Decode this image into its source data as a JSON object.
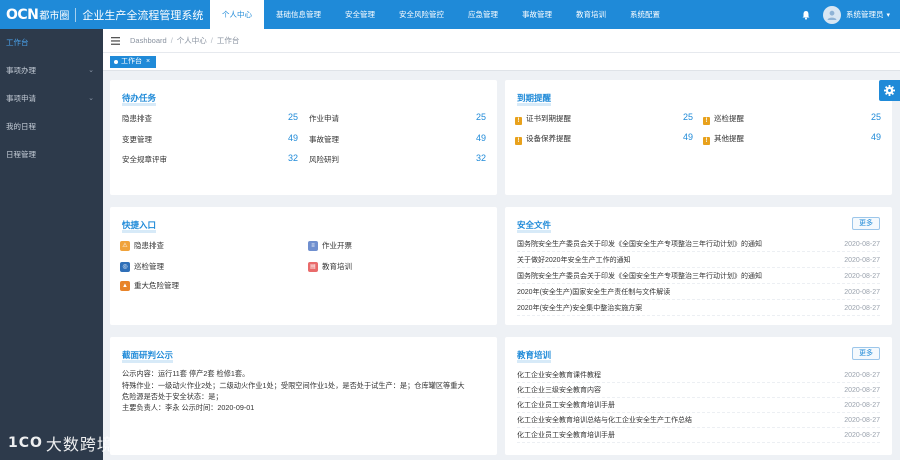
{
  "header": {
    "logo_mark": "OCN",
    "logo_name": "都市圈",
    "app_title": "企业生产全流程管理系统",
    "nav": [
      "个人中心",
      "基础信息管理",
      "安全管理",
      "安全风险管控",
      "应急管理",
      "事故管理",
      "教育培训",
      "系统配置"
    ],
    "user": "系统管理员"
  },
  "sidebar": {
    "items": [
      {
        "label": "工作台",
        "has_arrow": false
      },
      {
        "label": "事项办理",
        "has_arrow": true
      },
      {
        "label": "事项申请",
        "has_arrow": true
      },
      {
        "label": "我的日程",
        "has_arrow": false
      },
      {
        "label": "日程管理",
        "has_arrow": false
      }
    ]
  },
  "breadcrumb": [
    "Dashboard",
    "个人中心",
    "工作台"
  ],
  "tab": {
    "label": "工作台"
  },
  "tasks": {
    "title": "待办任务",
    "left": [
      {
        "label": "隐患排查",
        "value": "25"
      },
      {
        "label": "变更管理",
        "value": "49"
      },
      {
        "label": "安全规章评审",
        "value": "32"
      }
    ],
    "right": [
      {
        "label": "作业申请",
        "value": "25"
      },
      {
        "label": "事故管理",
        "value": "49"
      },
      {
        "label": "风险研判",
        "value": "32"
      }
    ]
  },
  "reminders": {
    "title": "到期提醒",
    "left": [
      {
        "label": "证书到期提醒",
        "value": "25"
      },
      {
        "label": "设备保养提醒",
        "value": "49"
      }
    ],
    "right": [
      {
        "label": "巡检提醒",
        "value": "25"
      },
      {
        "label": "其他提醒",
        "value": "49"
      }
    ]
  },
  "quick": {
    "title": "快捷入口",
    "items": [
      {
        "label": "隐患排查",
        "icon": "hazard-check-icon",
        "color": "#f0a23a"
      },
      {
        "label": "作业开票",
        "icon": "ticket-icon",
        "color": "#6f8fcf"
      },
      {
        "label": "巡检管理",
        "icon": "inspection-icon",
        "color": "#2f6fb8"
      },
      {
        "label": "教育培训",
        "icon": "training-icon",
        "color": "#e96b6b"
      },
      {
        "label": "重大危险管理",
        "icon": "major-hazard-icon",
        "color": "#e8842a"
      }
    ]
  },
  "safety_docs": {
    "title": "安全文件",
    "more": "更多",
    "items": [
      {
        "title": "国务院安全生产委员会关于印发《全国安全生产专项整治三年行动计划》的通知",
        "date": "2020-08-27"
      },
      {
        "title": "关于做好2020年安全生产工作的通知",
        "date": "2020-08-27"
      },
      {
        "title": "国务院安全生产委员会关于印发《全国安全生产专项整治三年行动计划》的通知",
        "date": "2020-08-27"
      },
      {
        "title": "2020年(安全生产)国家安全生产责任制与文件解读",
        "date": "2020-08-27"
      },
      {
        "title": "2020年(安全生产)安全集中整治实施方案",
        "date": "2020-08-27"
      }
    ]
  },
  "notice": {
    "title": "截面研判公示",
    "lines": [
      "公示内容：运行11套 停产2套 检修1套。",
      "特殊作业：一级动火作业2处；二级动火作业1处；受限空间作业1处，是否处于试生产：是；仓库罐区等重大",
      "危险源是否处于安全状态：是；",
      "主要负责人：李永  公示时间：2020-09-01"
    ]
  },
  "education": {
    "title": "教育培训",
    "more": "更多",
    "items": [
      {
        "title": "化工企业安全教育课件教程",
        "date": "2020-08-27"
      },
      {
        "title": "化工企业三级安全教育内容",
        "date": "2020-08-27"
      },
      {
        "title": "化工企业员工安全教育培训手册",
        "date": "2020-08-27"
      },
      {
        "title": "化工企业安全教育培训总结与化工企业安全生产工作总结",
        "date": "2020-08-27"
      },
      {
        "title": "化工企业员工安全教育培训手册",
        "date": "2020-08-27"
      }
    ]
  },
  "watermark": {
    "mark": "1CO",
    "text": "大数跨境"
  },
  "colors": {
    "primary": "#1f8ad8",
    "sidebar": "#2d3a4b",
    "warning": "#e8a11c"
  }
}
